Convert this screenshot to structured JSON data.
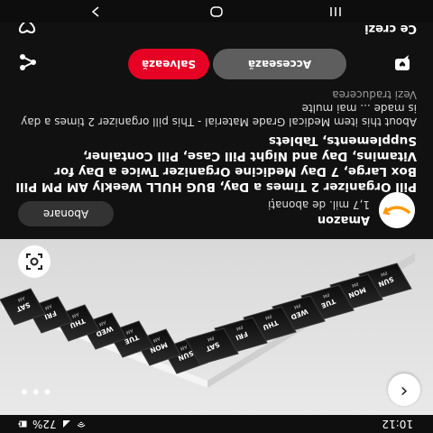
{
  "status_bar": {
    "time": "10:12",
    "battery": "72%"
  },
  "pin": {
    "image_alt_labels": {
      "top_row": [
        "SUN",
        "MON",
        "TUE",
        "WED",
        "THU",
        "FRI",
        "SAT"
      ],
      "bottom_row": [
        "SUN",
        "MON",
        "TUE",
        "WED",
        "THU",
        "FRI",
        "SAT"
      ],
      "top_marker": "AM",
      "bottom_marker": "PM"
    },
    "title": "Pill Organizer 2 Times a Day, BUG HULL Weekly AM PM Pill Box Large, 7 Day Medicine Organizer Twice a Day for Vitamins, Day and Night Pill Case, Pill Container, Supplements, Tablets",
    "description": "About this item Medical Grade Material - This pill organizer 2 times a day is made ... mai multe",
    "see_translation": "Vezi traducerea"
  },
  "profile": {
    "name": "Amazon",
    "followers": "1,7 mil. de abonați",
    "follow_label": "Abonare"
  },
  "actions": {
    "visit_label": "Accesează",
    "save_label": "Salvează"
  },
  "more_ideas": {
    "label": "Ce crezi"
  },
  "colors": {
    "background": "#111111",
    "save_red": "#e60023",
    "visit_gray": "#5e5e5e",
    "amazon_orange": "#ff9900"
  },
  "icons": [
    "back-arrow-icon",
    "more-icon",
    "visual-search-icon",
    "comment-icon",
    "share-icon",
    "heart-icon",
    "wifi-icon",
    "signal-icon",
    "battery-icon",
    "nav-back-icon",
    "nav-home-icon",
    "nav-recents-icon"
  ]
}
